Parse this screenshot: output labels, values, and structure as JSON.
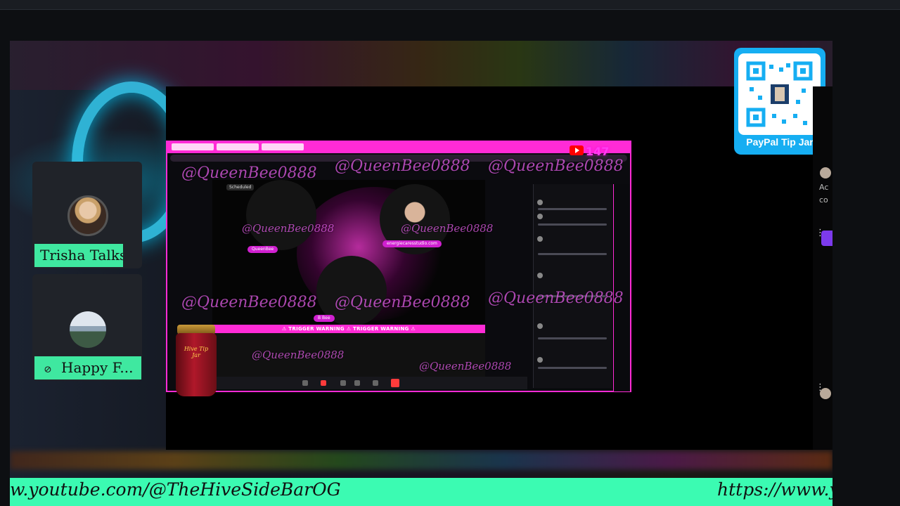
{
  "participants": [
    {
      "name": "Trisha Talks",
      "muted": false
    },
    {
      "name": "Happy F...",
      "muted": true
    }
  ],
  "tip_jar": {
    "label": "PayPal Tip Jar",
    "jar_label": "Hive Tip Jar"
  },
  "shared_screen": {
    "live_count": "147",
    "status": "Scheduled",
    "trigger_banner": "⚠ TRIGGER WARNING ⚠ TRIGGER WARNING ⚠",
    "watermark": "@QueenBee0888",
    "guest_labels": [
      "QueenBee",
      "energiecaresstudio.com",
      "B Bee"
    ]
  },
  "right_edge": {
    "text_a": "Ac",
    "text_b": "co"
  },
  "ticker": {
    "left_text": "w.youtube.com/@TheHiveSideBarOG",
    "right_text": "https://www.yo"
  },
  "colors": {
    "accent_green": "#3bfbb2",
    "accent_pink": "#ff2bd6",
    "tip_blue": "#16aef2"
  },
  "icons": [
    "mic-off-icon",
    "qr-code-icon",
    "youtube-icon",
    "more-vertical-icon"
  ]
}
